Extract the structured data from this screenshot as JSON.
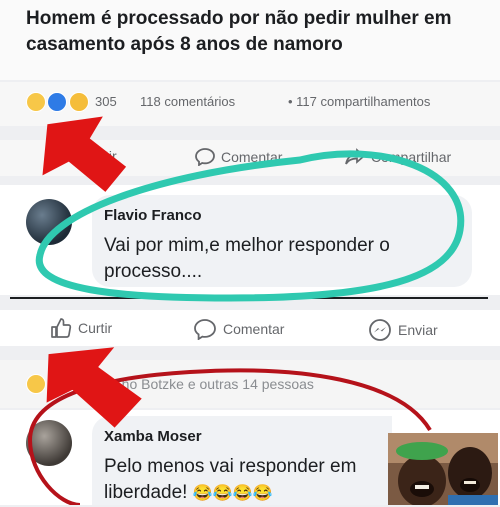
{
  "post": {
    "headline": "Homem é processado por não pedir mulher em casamento após 8 anos de namoro",
    "reaction_count": "305",
    "comments_count": "118 comentários",
    "shares_count": "• 117 compartilhamentos"
  },
  "top_actions": {
    "like": "tir",
    "comment": "Comentar",
    "share": "Compartilhar"
  },
  "comment1": {
    "author": "Flavio Franco",
    "text_line1": "Vai por mim,e melhor responder o",
    "text_line2": "processo...."
  },
  "actions": {
    "like": "Curtir",
    "comment": "Comentar",
    "send": "Enviar"
  },
  "reaction_summary": "...ho Botzke e outras 14 pessoas",
  "comment2": {
    "author": "Xamba Moser",
    "text_line1": "Pelo menos vai responder em",
    "text_line2": "liberdade!",
    "emojis": "😂😂😂😂"
  },
  "annotation_colors": {
    "circle": "#2fc9b0",
    "arrow": "#e01515",
    "oval": "#b5121a"
  }
}
